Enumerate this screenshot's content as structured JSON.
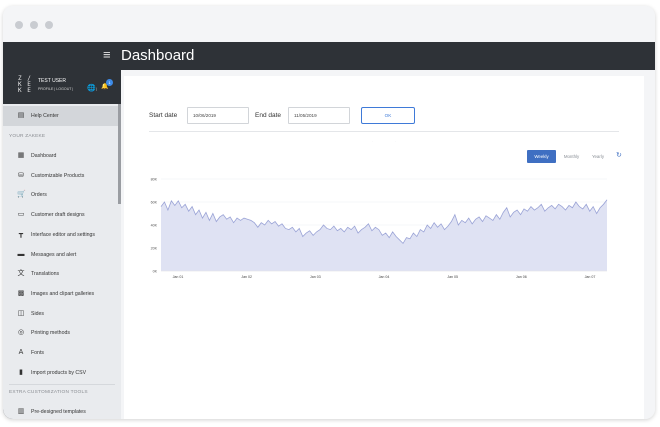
{
  "window": {
    "dots": [
      "#c9ccd1",
      "#c9ccd1",
      "#c9ccd1"
    ]
  },
  "topbar": {
    "menu_icon": "hamburger-icon",
    "title": "Dashboard"
  },
  "sidebar": {
    "logo": [
      "Z / ",
      "K E",
      "K E"
    ],
    "user_name": "TEST USER",
    "user_links": "PROFILE  |  LOGOUT  |",
    "notification_count": "1",
    "help": {
      "label": "Help Center",
      "icon": "document-icon"
    },
    "section1": "YOUR ZAKEKE",
    "items": [
      {
        "label": "Dashboard",
        "icon": "dashboard-icon"
      },
      {
        "label": "Customizable Products",
        "icon": "basket-icon"
      },
      {
        "label": "Orders",
        "icon": "cart-icon"
      },
      {
        "label": "Customer draft designs",
        "icon": "draft-icon"
      },
      {
        "label": "Interface editor and settings",
        "icon": "paint-roller-icon"
      },
      {
        "label": "Messages and alert",
        "icon": "message-icon"
      },
      {
        "label": "Translations",
        "icon": "translate-icon"
      },
      {
        "label": "Images and clipart galleries",
        "icon": "image-icon"
      },
      {
        "label": "Sides",
        "icon": "sides-icon"
      },
      {
        "label": "Printing methods",
        "icon": "printing-icon"
      },
      {
        "label": "Fonts",
        "icon": "font-icon"
      },
      {
        "label": "Import products by CSV",
        "icon": "file-icon"
      }
    ],
    "section2": "EXTRA CUSTOMIZATION TOOLS",
    "extra_items": [
      {
        "label": "Pre-designed templates",
        "icon": "templates-icon"
      }
    ]
  },
  "filters": {
    "start_label": "Start date",
    "start_value": "10/06/2019",
    "end_label": "End date",
    "end_value": "11/05/2019",
    "ok_label": "OK"
  },
  "tabs": [
    {
      "label": "Weekly",
      "selected": true
    },
    {
      "label": "Monthly",
      "selected": false
    },
    {
      "label": "Yearly",
      "selected": false
    }
  ],
  "refresh_icon": "refresh-icon",
  "colors": {
    "accent": "#3f6fc2",
    "sidebar_dark": "#2e3237",
    "area_fill": "#dfe2f3",
    "line": "#9aa3d6"
  },
  "chart_data": {
    "type": "area",
    "title": "",
    "xlabel": "",
    "ylabel": "",
    "ylim": [
      0,
      80000
    ],
    "yticks": [
      {
        "value": 0,
        "label": "0K"
      },
      {
        "value": 20000,
        "label": "20K"
      },
      {
        "value": 40000,
        "label": "40K"
      },
      {
        "value": 60000,
        "label": "60K"
      },
      {
        "value": 80000,
        "label": "80K"
      }
    ],
    "xticks": [
      "Jan 01",
      "Jan 02",
      "Jan 03",
      "Jan 04",
      "Jan 05",
      "Jan 06",
      "Jan 07"
    ],
    "grid": true,
    "series": [
      {
        "values": [
          56000,
          60000,
          53000,
          61000,
          57000,
          61000,
          55000,
          58000,
          52000,
          56000,
          49000,
          53000,
          46000,
          51000,
          44000,
          50000,
          43000,
          47000,
          49000,
          45000,
          47000,
          42000,
          46000,
          44000,
          46000,
          45000,
          44000,
          42000,
          38000,
          42000,
          40000,
          44000,
          41000,
          43000,
          39000,
          41000,
          37000,
          36000,
          38000,
          34000,
          37000,
          30000,
          33000,
          35000,
          31000,
          34000,
          36000,
          40000,
          37000,
          36000,
          39000,
          35000,
          37000,
          34000,
          38000,
          36000,
          39000,
          33000,
          36000,
          38000,
          41000,
          35000,
          38000,
          36000,
          31000,
          33000,
          29000,
          34000,
          30000,
          27000,
          24000,
          29000,
          28000,
          33000,
          30000,
          36000,
          34000,
          40000,
          37000,
          42000,
          38000,
          41000,
          36000,
          39000,
          43000,
          49000,
          40000,
          44000,
          42000,
          46000,
          41000,
          45000,
          47000,
          43000,
          48000,
          46000,
          44000,
          49000,
          45000,
          51000,
          55000,
          47000,
          51000,
          53000,
          49000,
          54000,
          52000,
          56000,
          53000,
          55000,
          58000,
          52000,
          55000,
          57000,
          54000,
          58000,
          56000,
          53000,
          57000,
          55000,
          60000,
          56000,
          54000,
          58000,
          52000,
          56000,
          50000,
          55000,
          58000,
          62000
        ]
      }
    ]
  }
}
